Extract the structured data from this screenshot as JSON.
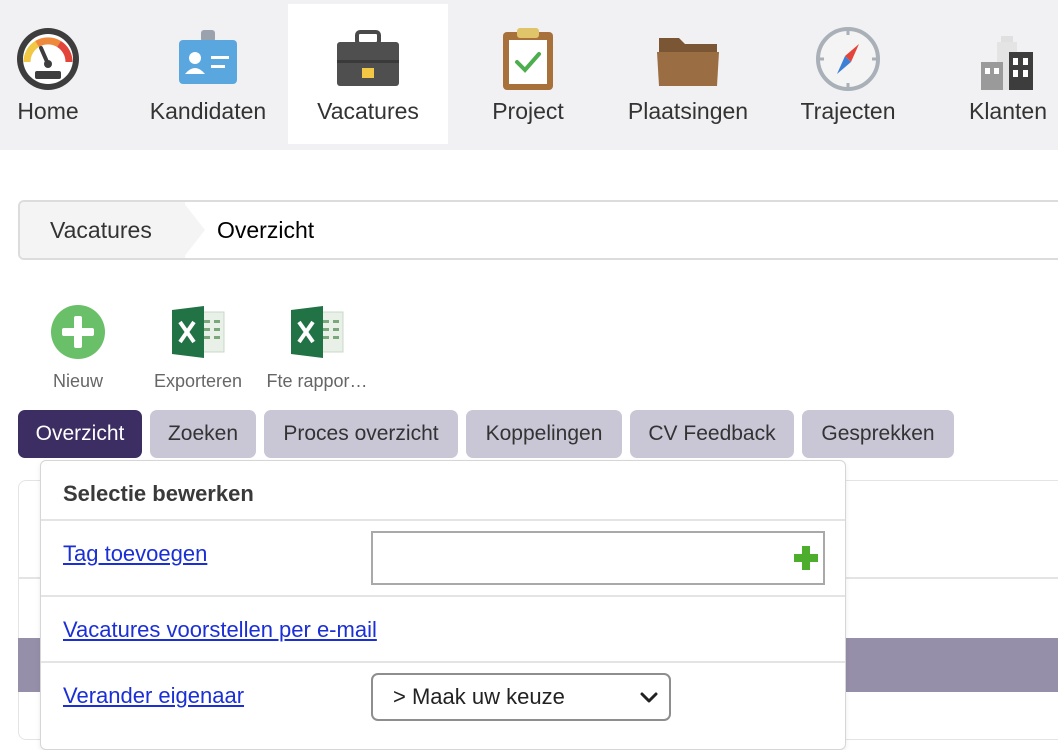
{
  "topnav": {
    "items": [
      {
        "label": "Home",
        "icon": "dashboard-gauge-icon"
      },
      {
        "label": "Kandidaten",
        "icon": "id-badge-icon"
      },
      {
        "label": "Vacatures",
        "icon": "briefcase-icon",
        "active": true
      },
      {
        "label": "Project",
        "icon": "clipboard-check-icon"
      },
      {
        "label": "Plaatsingen",
        "icon": "folder-icon"
      },
      {
        "label": "Trajecten",
        "icon": "compass-icon"
      },
      {
        "label": "Klanten",
        "icon": "buildings-icon"
      }
    ]
  },
  "breadcrumb": {
    "first": "Vacatures",
    "second": "Overzicht"
  },
  "toolbar": {
    "new_label": "Nieuw",
    "export_label": "Exporteren",
    "fte_label": "Fte rappor…"
  },
  "tabs": [
    {
      "label": "Overzicht",
      "active": true
    },
    {
      "label": "Zoeken"
    },
    {
      "label": "Proces overzicht"
    },
    {
      "label": "Koppelingen"
    },
    {
      "label": "CV Feedback"
    },
    {
      "label": "Gesprekken"
    }
  ],
  "selection_panel": {
    "title": "Selectie bewerken",
    "add_tag_link": "Tag toevoegen",
    "tag_input_value": "",
    "propose_email_link": "Vacatures voorstellen per e-mail",
    "change_owner_link": "Verander eigenaar",
    "owner_select_value": "> Maak uw keuze"
  },
  "colors": {
    "active_tab": "#3c2d62",
    "tab": "#c9c6d6",
    "link": "#1a2fd6",
    "table_header": "#968fa9"
  }
}
